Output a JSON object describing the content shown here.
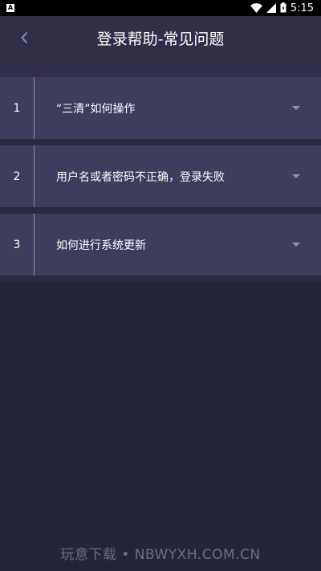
{
  "status_bar": {
    "notification_icon": "A",
    "icons": [
      "wifi-icon",
      "cell-signal-icon",
      "battery-icon"
    ],
    "time": "5:15"
  },
  "header": {
    "back_icon": "chevron-left-icon",
    "title": "登录帮助-常见问题"
  },
  "faq": {
    "items": [
      {
        "number": "1",
        "text": "“三清”如何操作"
      },
      {
        "number": "2",
        "text": "用户名或者密码不正确，登录失败"
      },
      {
        "number": "3",
        "text": "如何进行系统更新"
      }
    ]
  },
  "watermark": "玩意下载 • NBWYXH.COM.CN",
  "colors": {
    "background": "#25253a",
    "header": "#302f47",
    "item": "#3f3d5e",
    "divider": "#8d89b0",
    "accent_icon": "#8f8cc0"
  }
}
